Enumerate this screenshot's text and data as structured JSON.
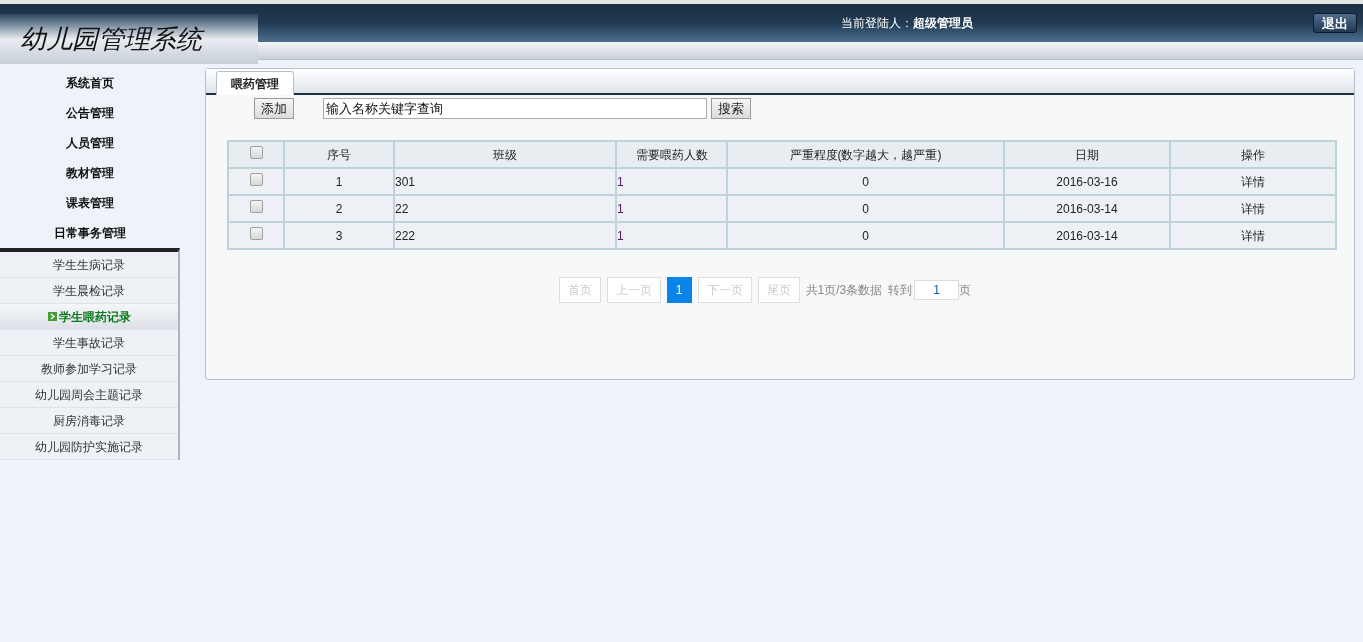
{
  "header": {
    "logo": "幼儿园管理系统",
    "current_user": "当前登陆人：**超级管理员**",
    "logout": "退出"
  },
  "sidebar": {
    "items": [
      {
        "label": "系统首页"
      },
      {
        "label": "公告管理"
      },
      {
        "label": "人员管理"
      },
      {
        "label": "教材管理"
      },
      {
        "label": "课表管理"
      },
      {
        "label": "日常事务管理",
        "expanded": true,
        "children": [
          {
            "label": "学生生病记录",
            "selected": false
          },
          {
            "label": "学生晨检记录",
            "selected": false
          },
          {
            "label": "学生喂药记录",
            "selected": true
          },
          {
            "label": "学生事故记录",
            "selected": false
          },
          {
            "label": "教师参加学习记录",
            "selected": false
          },
          {
            "label": "幼儿园周会主题记录",
            "selected": false
          },
          {
            "label": "厨房消毒记录",
            "selected": false
          },
          {
            "label": "幼儿园防护实施记录",
            "selected": false
          }
        ]
      }
    ]
  },
  "tabs": [
    {
      "label": "喂药管理",
      "selected": true
    }
  ],
  "toolbar": {
    "add": "添加",
    "search": {
      "value": "输入名称关键字查询"
    },
    "search_button": "搜索"
  },
  "table": {
    "select_all": {
      "checked": false
    },
    "columns": [
      "序号",
      "班级",
      "需要喂药人数",
      "严重程度(数字越大，越严重)",
      "日期",
      "操作"
    ],
    "rows": [
      {
        "checked": false,
        "cells": [
          "1",
          "301",
          "1",
          "0",
          "2016-03-16",
          "详情"
        ]
      },
      {
        "checked": false,
        "cells": [
          "2",
          "22",
          "1",
          "0",
          "2016-03-14",
          "详情"
        ]
      },
      {
        "checked": false,
        "cells": [
          "3",
          "222",
          "1",
          "0",
          "2016-03-14",
          "详情"
        ]
      }
    ]
  },
  "pagination": {
    "buttons": [
      {
        "label": "首页",
        "disabled": true,
        "selected": false
      },
      {
        "label": "上一页",
        "disabled": true,
        "selected": false
      },
      {
        "label": "1",
        "disabled": false,
        "selected": true
      },
      {
        "label": "下一页",
        "disabled": true,
        "selected": false
      },
      {
        "label": "尾页",
        "disabled": true,
        "selected": false
      }
    ],
    "summary": "共1页/3条数据",
    "goto_label": "转到",
    "goto_value": "1",
    "goto_suffix": "页"
  }
}
